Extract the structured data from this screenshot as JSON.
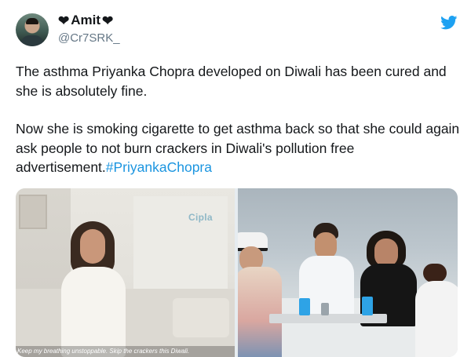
{
  "tweet": {
    "display_name": "Amit",
    "handle": "@Cr7SRK_",
    "paragraph1": "The asthma Priyanka Chopra developed on Diwali has been cured and she is absolutely fine.",
    "paragraph2_text": "Now she is smoking cigarette  to get asthma back so that she could again ask people to not burn crackers in Diwali's pollution free advertisement.",
    "hashtag": "#PriyankaChopra"
  },
  "media": {
    "left_logo": "Cipla",
    "left_caption": "Keep my breathing unstoppable. Skip the crackers this Diwali."
  },
  "icons": {
    "bird": "twitter-bird-icon",
    "heart": "black-heart-icon"
  },
  "colors": {
    "text": "#14171a",
    "secondary": "#657786",
    "link": "#1b95e0",
    "bird": "#1da1f2"
  }
}
